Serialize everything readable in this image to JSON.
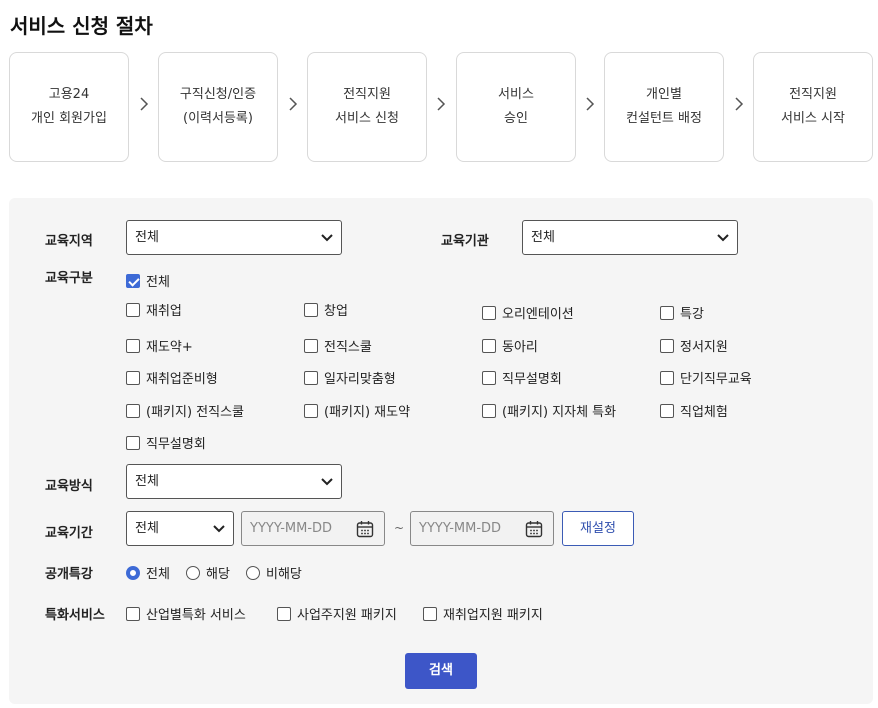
{
  "page": {
    "title": "서비스 신청 절차"
  },
  "steps": [
    {
      "line1": "고용24",
      "line2": "개인 회원가입"
    },
    {
      "line1": "구직신청/인증",
      "line2": "(이력서등록)"
    },
    {
      "line1": "전직지원",
      "line2": "서비스 신청"
    },
    {
      "line1": "서비스",
      "line2": "승인"
    },
    {
      "line1": "개인별",
      "line2": "컨설턴트 배정"
    },
    {
      "line1": "전직지원",
      "line2": "서비스 시작"
    }
  ],
  "icons": {
    "step_separator": "chevron-right-icon",
    "date_picker": "calendar-icon",
    "select_caret": "chevron-down-icon"
  },
  "form": {
    "region": {
      "label": "교육지역",
      "value": "전체"
    },
    "institution": {
      "label": "교육기관",
      "value": "전체"
    },
    "category": {
      "label": "교육구분",
      "all": {
        "label": "전체",
        "checked": true
      },
      "options": [
        {
          "label": "재취업",
          "checked": false
        },
        {
          "label": "창업",
          "checked": false
        },
        {
          "label": "오리엔테이션",
          "checked": false
        },
        {
          "label": "특강",
          "checked": false
        },
        {
          "label": "재도약+",
          "checked": false
        },
        {
          "label": "전직스쿨",
          "checked": false
        },
        {
          "label": "동아리",
          "checked": false
        },
        {
          "label": "정서지원",
          "checked": false
        },
        {
          "label": "재취업준비형",
          "checked": false
        },
        {
          "label": "일자리맞춤형",
          "checked": false
        },
        {
          "label": "직무설명회",
          "checked": false
        },
        {
          "label": "단기직무교육",
          "checked": false
        },
        {
          "label": "(패키지) 전직스쿨",
          "checked": false
        },
        {
          "label": "(패키지) 재도약",
          "checked": false
        },
        {
          "label": "(패키지) 지자체 특화",
          "checked": false
        },
        {
          "label": "직업체험",
          "checked": false
        },
        {
          "label": "직무설명회",
          "checked": false
        }
      ]
    },
    "method": {
      "label": "교육방식",
      "value": "전체"
    },
    "period": {
      "label": "교육기간",
      "type_value": "전체",
      "start_placeholder": "YYYY-MM-DD",
      "separator": "~",
      "end_placeholder": "YYYY-MM-DD",
      "reset_label": "재설정"
    },
    "public_lecture": {
      "label": "공개특강",
      "options": [
        {
          "label": "전체",
          "selected": true
        },
        {
          "label": "해당",
          "selected": false
        },
        {
          "label": "비해당",
          "selected": false
        }
      ]
    },
    "special_service": {
      "label": "특화서비스",
      "options": [
        {
          "label": "산업별특화 서비스",
          "checked": false
        },
        {
          "label": "사업주지원 패키지",
          "checked": false
        },
        {
          "label": "재취업지원 패키지",
          "checked": false
        }
      ]
    },
    "search_label": "검색"
  },
  "colors": {
    "accent": "#3d56c8",
    "checkbox_on": "#3d6ad6",
    "panel_bg": "#f5f5f5"
  }
}
